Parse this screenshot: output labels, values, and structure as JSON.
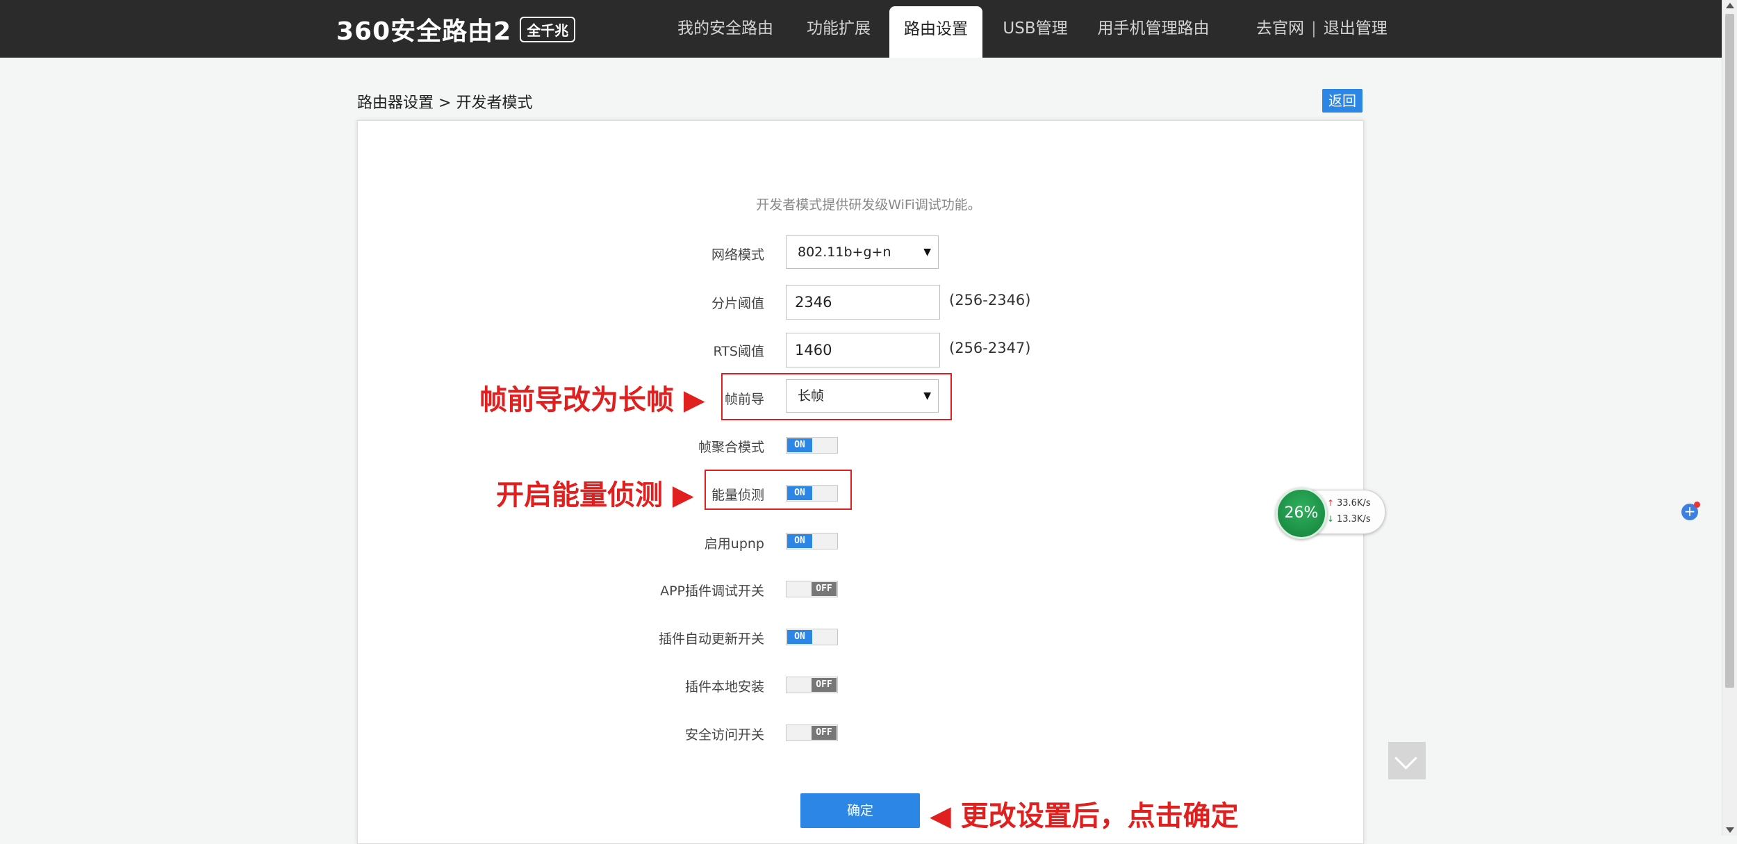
{
  "header": {
    "logo_text": "360安全路由2",
    "logo_badge": "全千兆",
    "nav": [
      {
        "label": "我的安全路由",
        "active": false
      },
      {
        "label": "功能扩展",
        "active": false
      },
      {
        "label": "路由设置",
        "active": true
      },
      {
        "label": "USB管理",
        "active": false
      },
      {
        "label": "用手机管理路由",
        "active": false
      }
    ],
    "links": {
      "official": "去官网",
      "separator": "|",
      "logout": "退出管理"
    }
  },
  "breadcrumb": {
    "parent": "路由器设置",
    "sep": ">",
    "current": "开发者模式"
  },
  "back_button": "返回",
  "description": "开发者模式提供研发级WiFi调试功能。",
  "form": {
    "network_mode": {
      "label": "网络模式",
      "value": "802.11b+g+n"
    },
    "frag_threshold": {
      "label": "分片阈值",
      "value": "2346",
      "range": "(256-2346)"
    },
    "rts_threshold": {
      "label": "RTS阈值",
      "value": "1460",
      "range": "(256-2347)"
    },
    "preamble": {
      "label": "帧前导",
      "value": "长帧"
    },
    "frame_aggregation": {
      "label": "帧聚合模式",
      "state": "ON"
    },
    "energy_detect": {
      "label": "能量侦测",
      "state": "ON"
    },
    "upnp": {
      "label": "启用upnp",
      "state": "ON"
    },
    "app_plugin_debug": {
      "label": "APP插件调试开关",
      "state": "OFF"
    },
    "plugin_auto_update": {
      "label": "插件自动更新开关",
      "state": "ON"
    },
    "plugin_local_install": {
      "label": "插件本地安装",
      "state": "OFF"
    },
    "secure_access": {
      "label": "安全访问开关",
      "state": "OFF"
    }
  },
  "confirm_button": "确定",
  "annotations": {
    "preamble": "帧前导改为长帧 ▶",
    "energy": "开启能量侦测 ▶",
    "confirm": "◀ 更改设置后，点击确定"
  },
  "speed_widget": {
    "percent": "26%",
    "upload": "33.6K/s",
    "download": "13.3K/s",
    "plus": "+"
  },
  "colors": {
    "accent": "#2b86e6",
    "topbar": "#2b2b2b",
    "annotation": "#e01f1f",
    "widget_green": "#1a9a4a"
  }
}
